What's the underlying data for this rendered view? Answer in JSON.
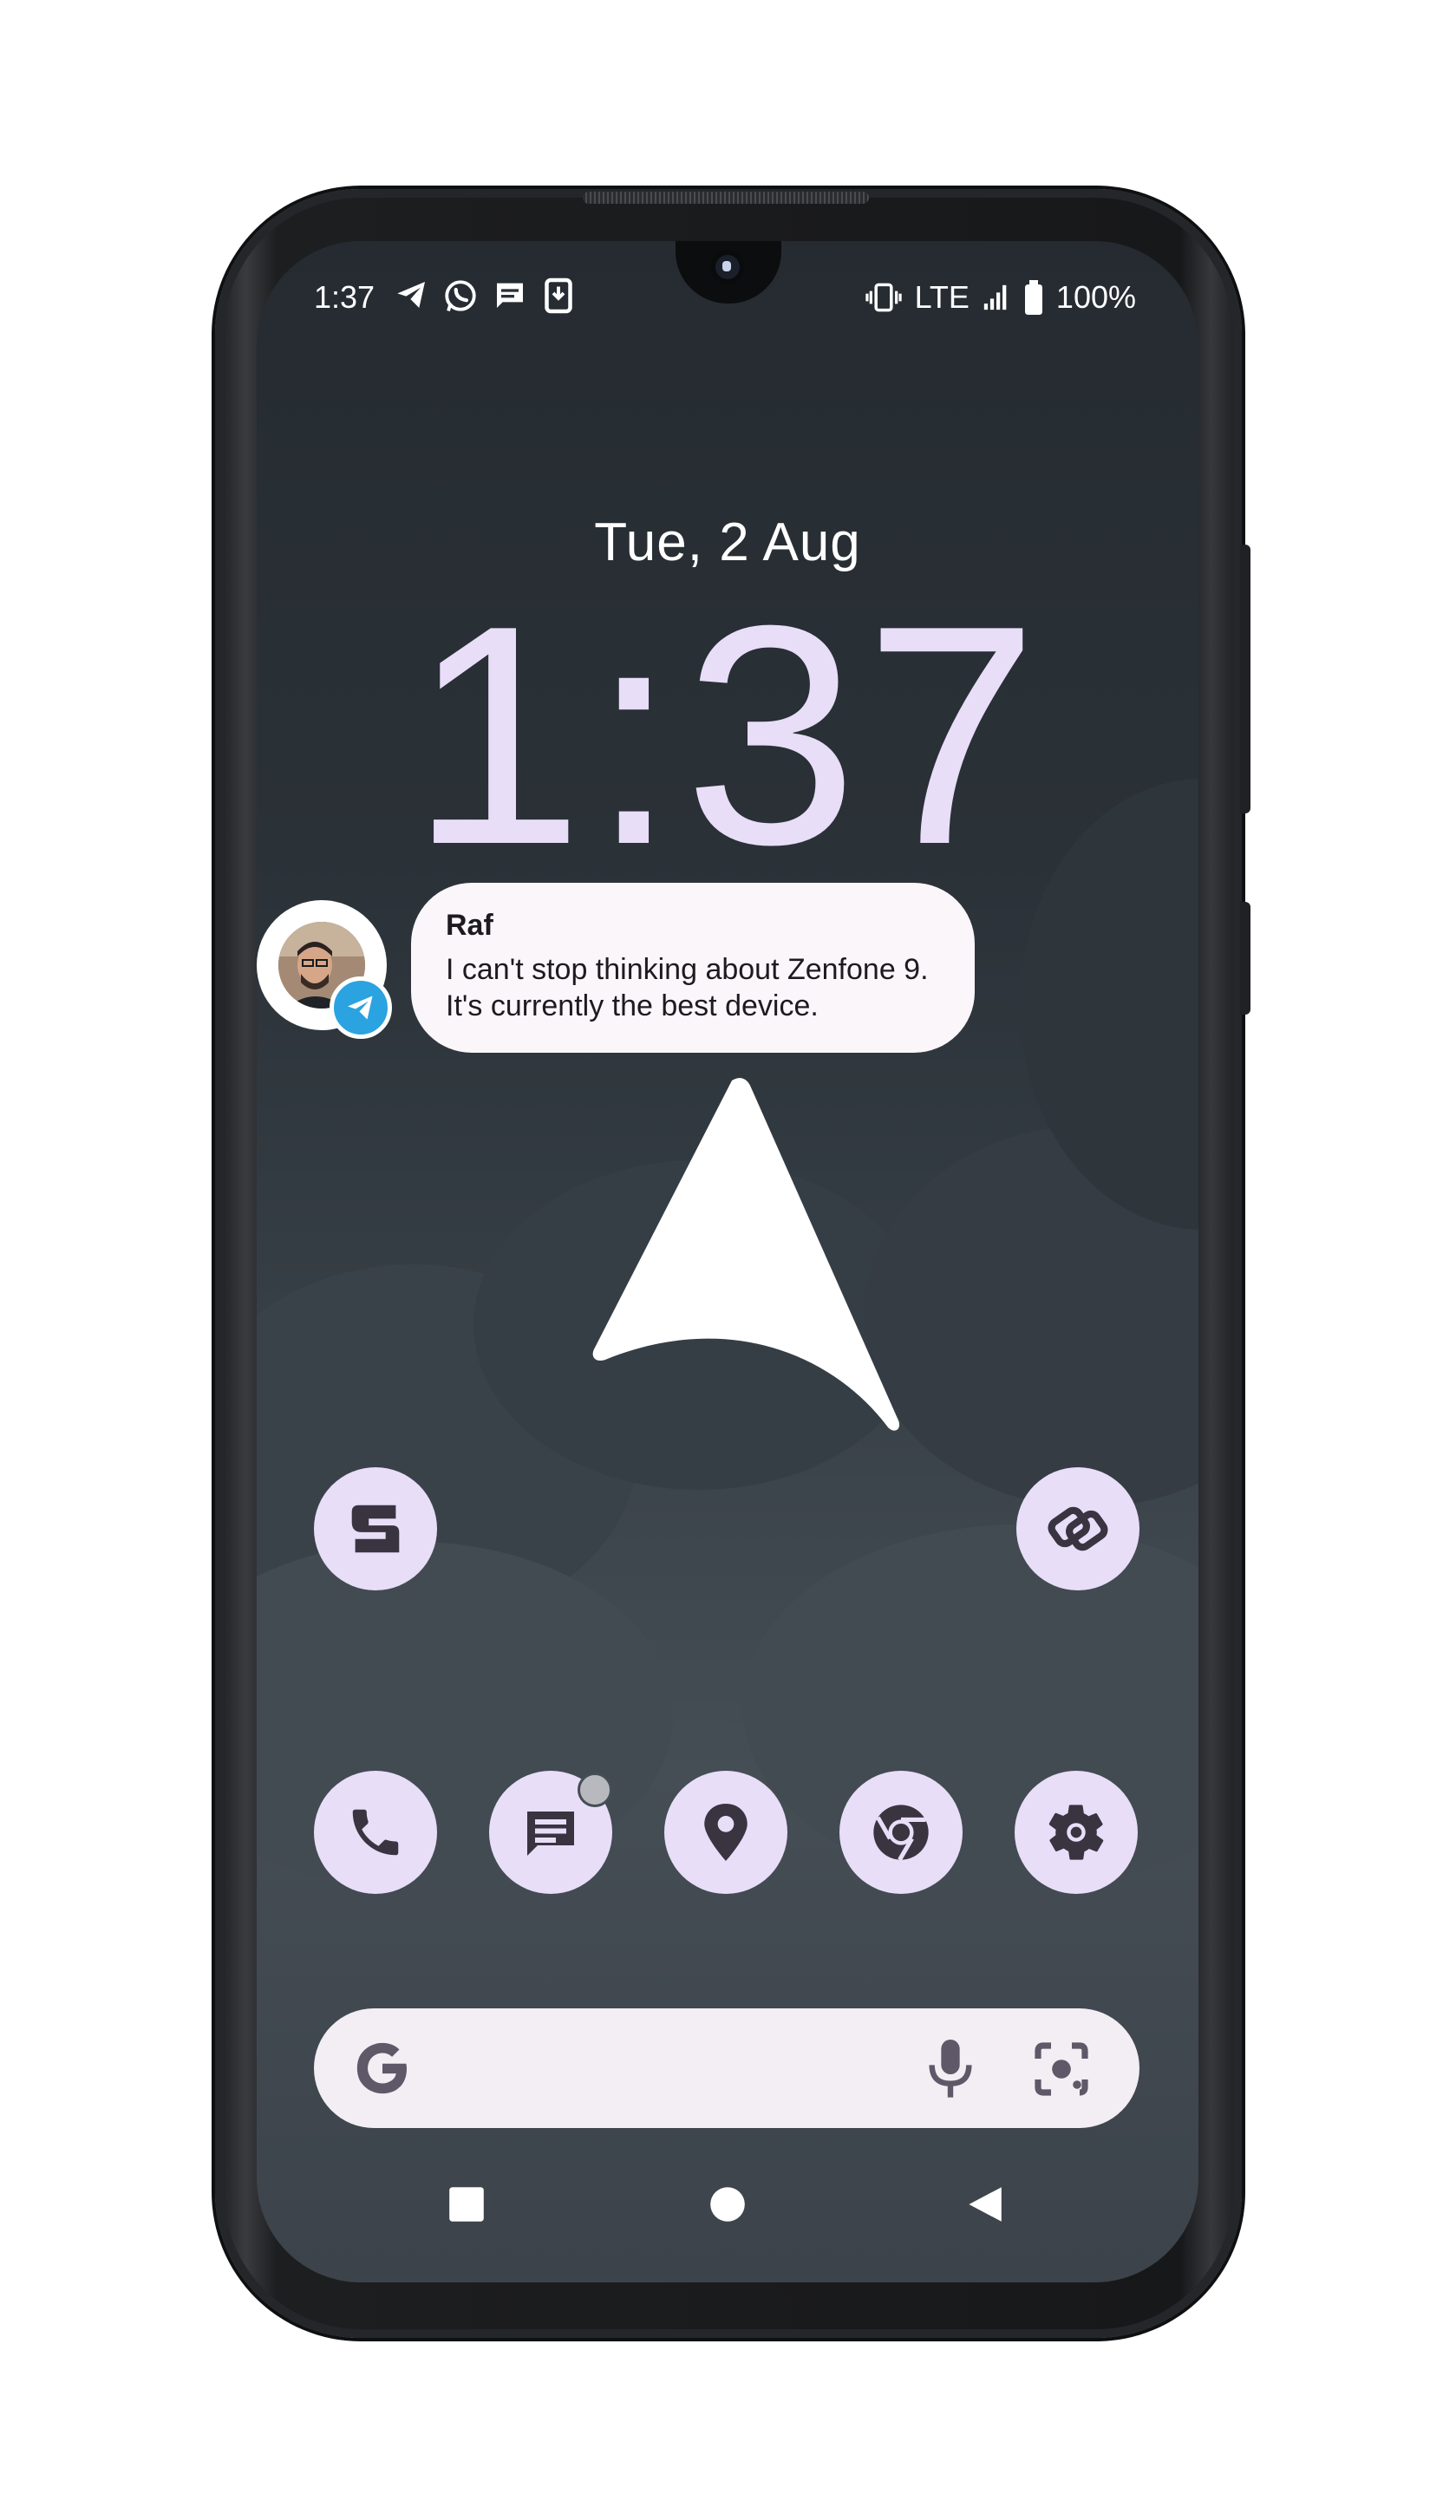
{
  "status_bar": {
    "time": "1:37",
    "network": "LTE",
    "battery": "100%",
    "left_icons": [
      "telegram-icon",
      "whatsapp-icon",
      "messages-icon",
      "download-icon"
    ],
    "right_icons": [
      "vibrate-icon",
      "signal-icon",
      "battery-icon"
    ]
  },
  "lockscreen": {
    "date": "Tue, 2 Aug",
    "clock": "1:37"
  },
  "bubble": {
    "sender": "Raf",
    "message": "I can't stop thinking about Zenfone 9. It's currently the best device.",
    "app_icon": "telegram-icon"
  },
  "wallpaper": {
    "logo": "arrow-logo"
  },
  "home_row": {
    "left_app": "swipe-app-icon",
    "right_app": "link-app-icon"
  },
  "dock": {
    "apps": [
      "phone-icon",
      "messages-icon",
      "maps-icon",
      "chrome-icon",
      "settings-icon"
    ],
    "notification_dot_on": "messages-icon"
  },
  "search_bar": {
    "logo": "G",
    "icons": [
      "mic-icon",
      "lens-icon"
    ]
  },
  "nav_bar": {
    "buttons": [
      "recents-button",
      "home-button",
      "back-button"
    ]
  },
  "colors": {
    "accent": "#e8def8",
    "icon_fg": "#3a3441",
    "telegram": "#2aa3e0",
    "screen_top": "#252b31",
    "screen_mid": "#454d55"
  }
}
